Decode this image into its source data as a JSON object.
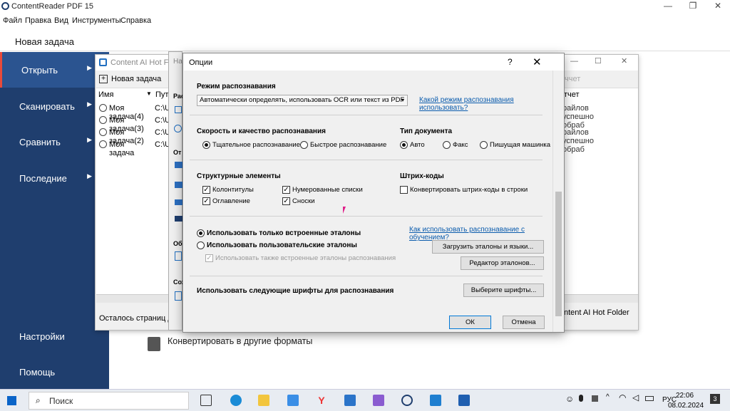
{
  "app": {
    "title": "ContentReader PDF 15"
  },
  "menu": [
    "Файл",
    "Правка",
    "Вид",
    "Инструменты",
    "Справка"
  ],
  "task_title": "Новая задача",
  "sidebar": {
    "items": [
      {
        "label": "Открыть",
        "arrow": "▶"
      },
      {
        "label": "Сканировать",
        "arrow": "▶"
      },
      {
        "label": "Сравнить",
        "arrow": "▶"
      },
      {
        "label": "Последние",
        "arrow": "▶"
      }
    ],
    "settings": "Настройки",
    "help": "Помощь"
  },
  "main": {
    "convert_label": "Конвертировать в другие форматы"
  },
  "hot_folder": {
    "title": "Content AI Hot Fol",
    "new_task": "Новая задача",
    "col_name": "Имя",
    "col_path": "Пут",
    "col_report": "тчет",
    "header_report_tail": "ччет",
    "rows": [
      {
        "name": "Моя задача(4)",
        "path": "C:\\U:",
        "result": "райлов успешно обраб"
      },
      {
        "name": "Моя задача(3)",
        "path": "C:\\U:",
        "result": ""
      },
      {
        "name": "Моя задача(2)",
        "path": "C:\\U:",
        "result": "райлов успешно обраб"
      },
      {
        "name": "Моя задача",
        "path": "C:\\U:",
        "result": ""
      }
    ],
    "status": "Осталось страниц для",
    "footer_right": "ntent AI Hot Folder",
    "partial_title": "Нас",
    "side_labels": [
      "Рас",
      "От",
      "Обр",
      "Сох"
    ]
  },
  "dialog": {
    "title": "Опции",
    "help": "?",
    "close": "✕",
    "recognition_mode": {
      "heading": "Режим распознавания",
      "value": "Автоматически определять, использовать OCR или текст из PDF",
      "link": "Какой режим распознавания использовать?"
    },
    "speed": {
      "heading": "Скорость и качество распознавания",
      "thorough": "Тщательное распознавание",
      "fast": "Быстрое распознавание"
    },
    "doc_type": {
      "heading": "Тип документа",
      "auto": "Авто",
      "fax": "Факс",
      "typewriter": "Пишущая машинка"
    },
    "structure": {
      "heading": "Структурные элементы",
      "headers": "Колонтитулы",
      "toc": "Оглавление",
      "numbered": "Нумерованные списки",
      "footnotes": "Сноски"
    },
    "barcodes": {
      "heading": "Штрих-коды",
      "convert": "Конвертировать штрих-коды в строки"
    },
    "patterns": {
      "builtin_only": "Использовать только встроенные эталоны",
      "user": "Использовать пользовательские эталоны",
      "also_builtin": "Использовать также встроенные эталоны распознавания",
      "link": "Как использовать распознавание с обучением?",
      "load_button": "Загрузить эталоны и языки...",
      "editor_button": "Редактор эталонов..."
    },
    "fonts": {
      "label": "Использовать следующие шрифты для распознавания",
      "button": "Выберите шрифты..."
    },
    "ok": "ОК",
    "cancel": "Отмена"
  },
  "taskbar": {
    "search": "Поиск",
    "lang": "РУС",
    "time": "22:06",
    "date": "08.02.2024",
    "notif_count": "3"
  }
}
